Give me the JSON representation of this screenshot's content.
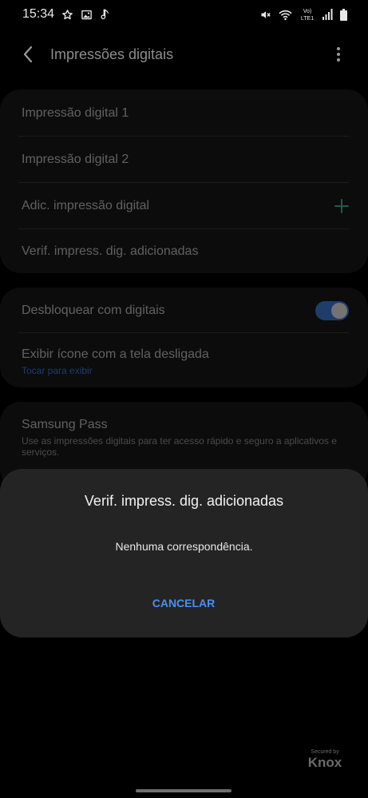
{
  "status_bar": {
    "time": "15:34",
    "notification_icons": [
      "star-icon",
      "image-icon",
      "music-note-icon"
    ],
    "system_icons": [
      "mute-icon",
      "wifi-icon",
      "volte-lte-icon",
      "signal-icon",
      "battery-icon"
    ],
    "volte_label": "Vo)",
    "lte_label": "LTE1"
  },
  "app_bar": {
    "title": "Impressões digitais",
    "back_icon": "chevron-left-icon",
    "more_icon": "more-vertical-icon"
  },
  "fingerprints_card": {
    "items": [
      {
        "label": "Impressão digital 1"
      },
      {
        "label": "Impressão digital 2"
      },
      {
        "label": "Adic. impressão digital",
        "icon": "plus-icon"
      },
      {
        "label": "Verif. impress. dig. adicionadas"
      }
    ]
  },
  "options_card": {
    "unlock": {
      "label": "Desbloquear com digitais",
      "enabled": true
    },
    "show_icon": {
      "label": "Exibir ícone com a tela desligada",
      "subtitle": "Tocar para exibir"
    }
  },
  "samsung_pass": {
    "title": "Samsung Pass",
    "description": "Use as impressões digitais para ter acesso rápido e seguro a aplicativos e serviços."
  },
  "dialog": {
    "title": "Verif. impress. dig. adicionadas",
    "message": "Nenhuma correspondência.",
    "cancel_label": "CANCELAR"
  },
  "footer": {
    "secured_by": "Secured by",
    "brand": "Knox"
  },
  "colors": {
    "accent": "#3f7fe0",
    "card": "#1b1b1b",
    "dialog": "#242424",
    "background": "#000000"
  }
}
